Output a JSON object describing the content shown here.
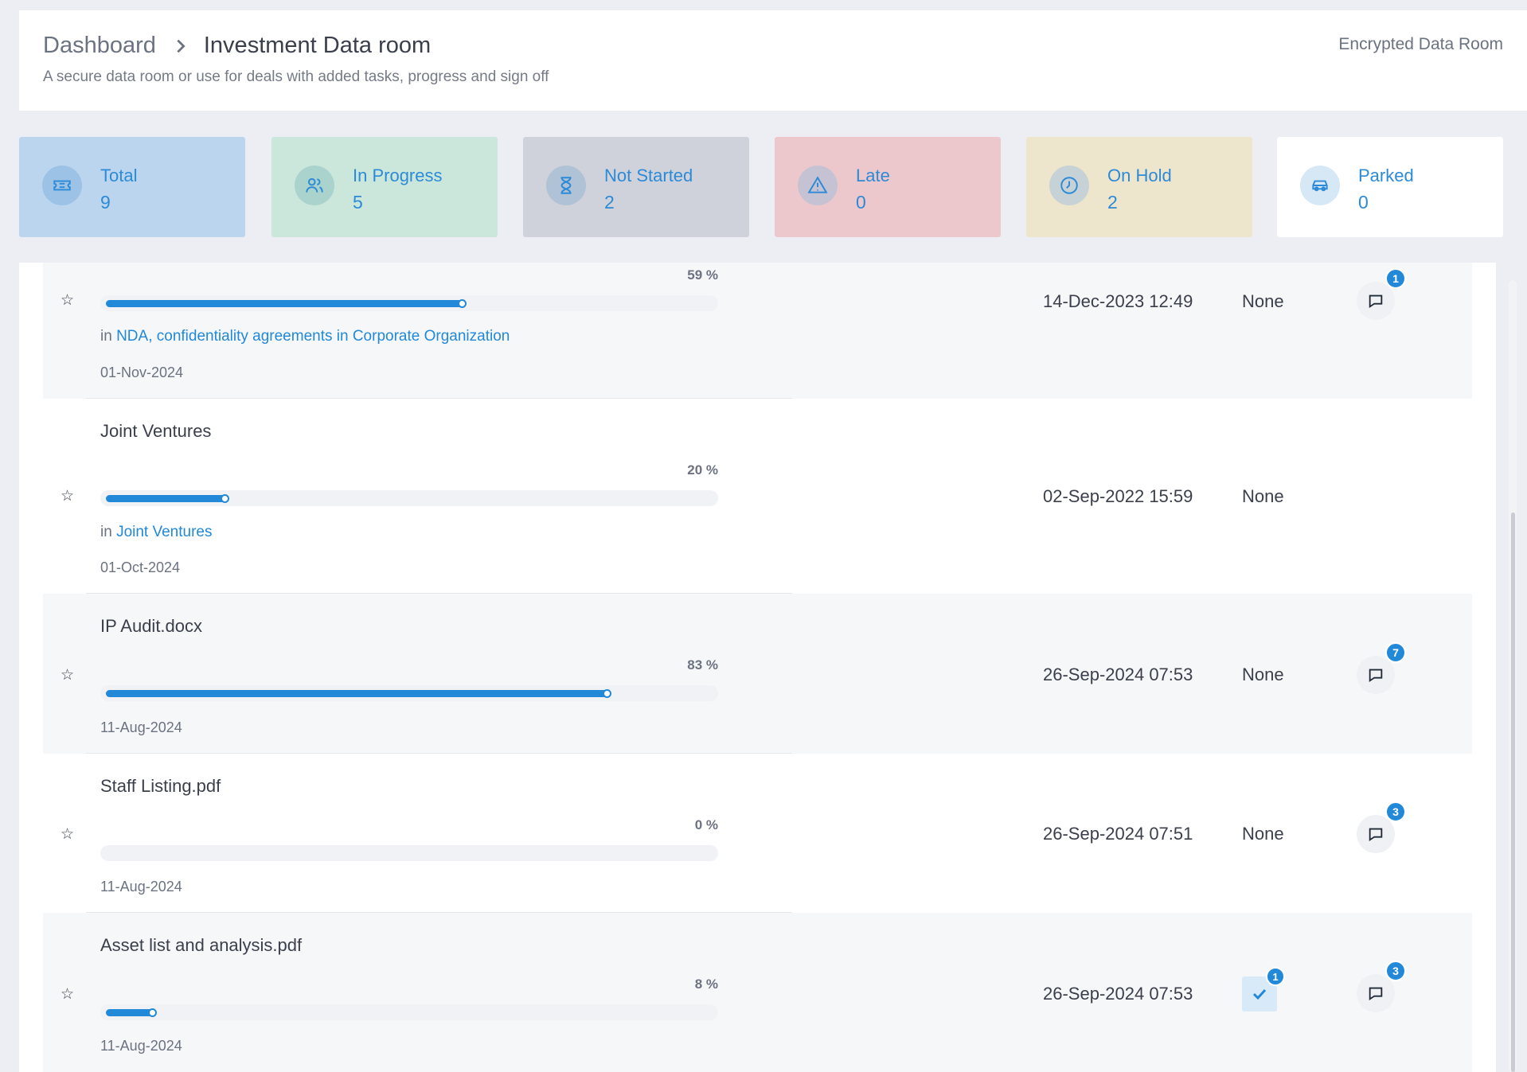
{
  "header": {
    "breadcrumb_root": "Dashboard",
    "breadcrumb_current": "Investment Data room",
    "subtitle": "A secure data room or use for deals with added tasks, progress and sign off",
    "encrypted_label": "Encrypted Data Room"
  },
  "stats": [
    {
      "label": "Total",
      "value": "9",
      "icon": "ticket-icon",
      "bg": "#bbd5ee",
      "icon_bg": "#9cc2e6"
    },
    {
      "label": "In Progress",
      "value": "5",
      "icon": "users-icon",
      "bg": "#cbe7dc",
      "icon_bg": "#a9d3cc"
    },
    {
      "label": "Not Started",
      "value": "2",
      "icon": "hourglass-icon",
      "bg": "#cfd2db",
      "icon_bg": "#b0c2d6"
    },
    {
      "label": "Late",
      "value": "0",
      "icon": "warning-icon",
      "bg": "#ecc8cd",
      "icon_bg": "#c5c2d3"
    },
    {
      "label": "On Hold",
      "value": "2",
      "icon": "clock-icon",
      "bg": "#eee5cd",
      "icon_bg": "#c7d2d6"
    },
    {
      "label": "Parked",
      "value": "0",
      "icon": "car-icon",
      "bg": "#ffffff",
      "icon_bg": "#d6e7f6"
    }
  ],
  "rows": [
    {
      "title": "",
      "percent_label": "59 %",
      "progress": 0.59,
      "in_prefix": "in",
      "in_link": "NDA, confidentiality agreements in Corporate Organization",
      "due": "01-Nov-2024",
      "modified": "14-Dec-2023 12:49",
      "status": "None",
      "comments": "1"
    },
    {
      "title": "Joint Ventures",
      "percent_label": "20 %",
      "progress": 0.2,
      "in_prefix": "in",
      "in_link": "Joint Ventures",
      "due": "01-Oct-2024",
      "modified": "02-Sep-2022 15:59",
      "status": "None"
    },
    {
      "title": "IP Audit.docx",
      "percent_label": "83 %",
      "progress": 0.83,
      "due": "11-Aug-2024",
      "modified": "26-Sep-2024 07:53",
      "status": "None",
      "comments": "7"
    },
    {
      "title": "Staff Listing.pdf",
      "percent_label": "0 %",
      "progress": 0,
      "due": "11-Aug-2024",
      "modified": "26-Sep-2024 07:51",
      "status": "None",
      "comments": "3"
    },
    {
      "title": "Asset list and analysis.pdf",
      "percent_label": "8 %",
      "progress": 0.08,
      "due": "11-Aug-2024",
      "modified": "26-Sep-2024 07:53",
      "approvals": "1",
      "comments": "3"
    }
  ],
  "colors": {
    "accent": "#2288d8",
    "background": "#edeef3"
  }
}
